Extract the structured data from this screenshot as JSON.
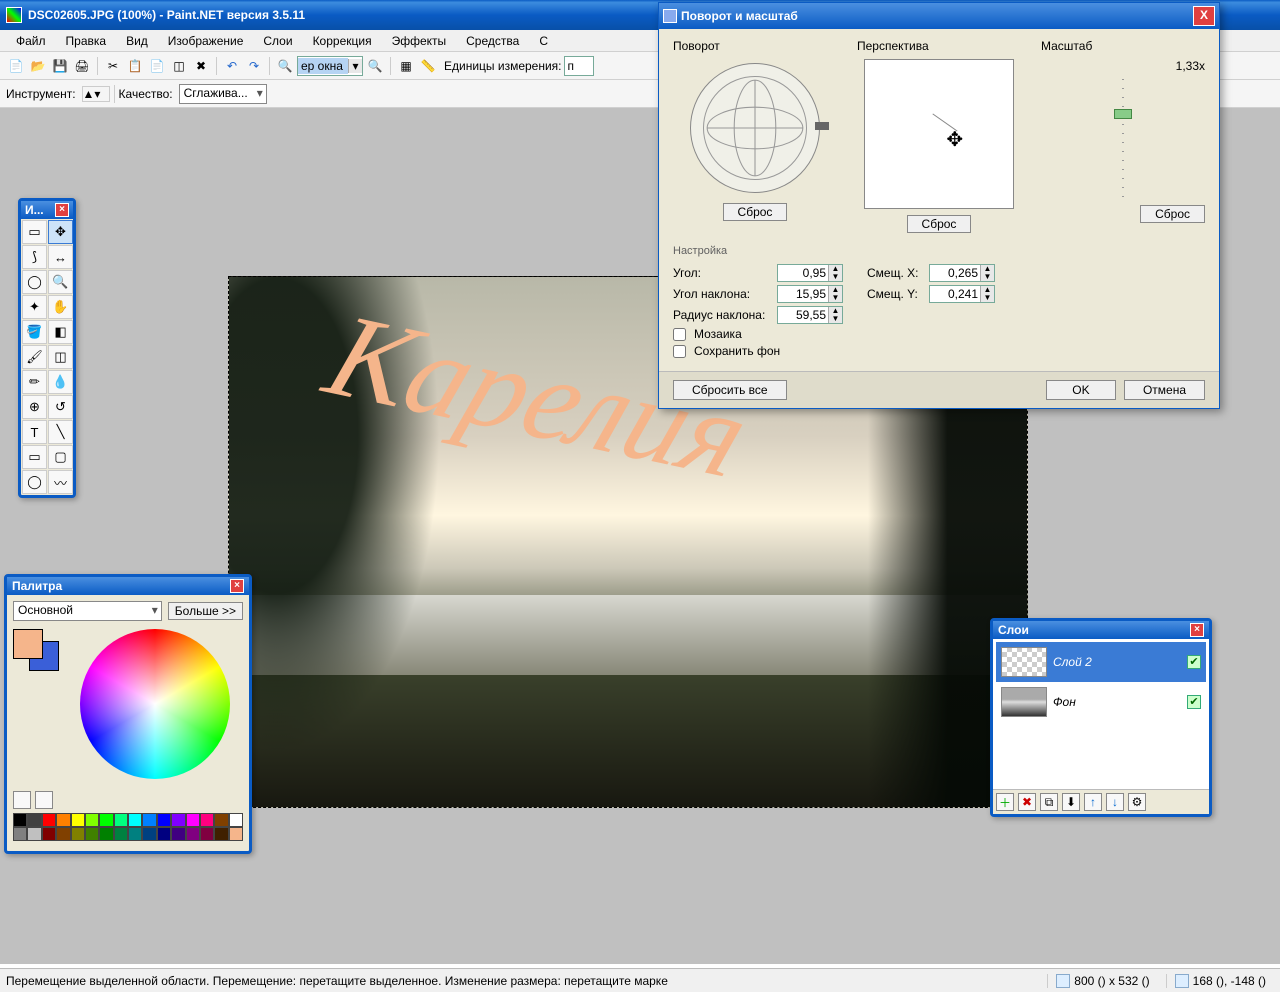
{
  "title": "DSC02605.JPG (100%) - Paint.NET версия 3.5.11",
  "menubar": [
    "Файл",
    "Правка",
    "Вид",
    "Изображение",
    "Слои",
    "Коррекция",
    "Эффекты",
    "Средства",
    "С"
  ],
  "toolbar": {
    "zoom_value": "ер окна",
    "units_label": "Единицы измерения:",
    "units_value": "п"
  },
  "toolrow2": {
    "instrument_label": "Инструмент:",
    "quality_label": "Качество:",
    "quality_value": "Сглажива..."
  },
  "image_text": "Карелия",
  "tools_win": {
    "title": "И..."
  },
  "palette": {
    "title": "Палитра",
    "mode": "Основной",
    "more": "Больше >>",
    "fg_color": "#f5b58b",
    "bg_color": "#3a5fd8",
    "swatches": [
      "#000",
      "#404040",
      "#ff0000",
      "#ff8000",
      "#ffff00",
      "#80ff00",
      "#00ff00",
      "#00ff80",
      "#00ffff",
      "#0080ff",
      "#0000ff",
      "#8000ff",
      "#ff00ff",
      "#ff0080",
      "#804000",
      "#ffffff",
      "#808080",
      "#c0c0c0",
      "#800000",
      "#804000",
      "#808000",
      "#408000",
      "#008000",
      "#008040",
      "#008080",
      "#004080",
      "#000080",
      "#400080",
      "#800080",
      "#800040",
      "#402000",
      "#f5b58b"
    ]
  },
  "layers": {
    "title": "Слои",
    "items": [
      {
        "name": "Слой 2",
        "selected": true,
        "thumb": "checker"
      },
      {
        "name": "Фон",
        "selected": false,
        "thumb": "img"
      }
    ]
  },
  "dialog": {
    "title": "Поворот и масштаб",
    "sections": {
      "rotate": "Поворот",
      "perspective": "Перспектива",
      "scale": "Масштаб"
    },
    "scale_value": "1,33x",
    "reset": "Сброс",
    "settings_title": "Настройка",
    "fields": {
      "angle_label": "Угол:",
      "angle": "0,95",
      "tilt_angle_label": "Угол наклона:",
      "tilt_angle": "15,95",
      "tilt_radius_label": "Радиус наклона:",
      "tilt_radius": "59,55",
      "offset_x_label": "Смещ. X:",
      "offset_x": "0,265",
      "offset_y_label": "Смещ. Y:",
      "offset_y": "0,241"
    },
    "checks": {
      "tile": "Мозаика",
      "keep_bg": "Сохранить фон"
    },
    "buttons": {
      "reset_all": "Сбросить все",
      "ok": "OK",
      "cancel": "Отмена"
    }
  },
  "statusbar": {
    "hint": "Перемещение выделенной области. Перемещение: перетащите выделенное. Изменение размера: перетащите марке",
    "size": "800 () x 532 ()",
    "pos": "168 (), -148 ()"
  }
}
